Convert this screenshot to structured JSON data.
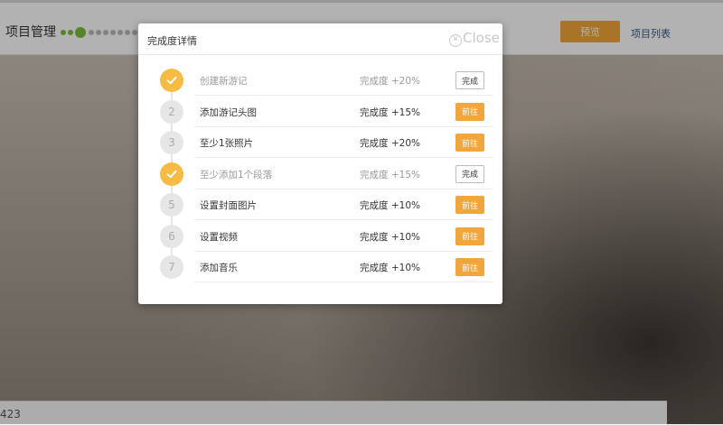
{
  "header": {
    "title": "项目管理",
    "preview_label": "预览",
    "project_list_label": "项目列表"
  },
  "bottom_bar": {
    "text": "423"
  },
  "modal": {
    "title": "完成度详情",
    "close_label": "Close",
    "tasks": [
      {
        "step": "1",
        "name": "创建新游记",
        "percent": "完成度 +20%",
        "action": "完成",
        "done": true
      },
      {
        "step": "2",
        "name": "添加游记头图",
        "percent": "完成度 +15%",
        "action": "前往",
        "done": false
      },
      {
        "step": "3",
        "name": "至少1张照片",
        "percent": "完成度 +20%",
        "action": "前往",
        "done": false
      },
      {
        "step": "4",
        "name": "至少添加1个段落",
        "percent": "完成度 +15%",
        "action": "完成",
        "done": true
      },
      {
        "step": "5",
        "name": "设置封面图片",
        "percent": "完成度 +10%",
        "action": "前往",
        "done": false
      },
      {
        "step": "6",
        "name": "设置视频",
        "percent": "完成度 +10%",
        "action": "前往",
        "done": false
      },
      {
        "step": "7",
        "name": "添加音乐",
        "percent": "完成度 +10%",
        "action": "前往",
        "done": false
      }
    ]
  },
  "colors": {
    "accent_orange": "#f2a53a",
    "step_done": "#f5bb43",
    "progress_green": "#7cbd3a"
  }
}
